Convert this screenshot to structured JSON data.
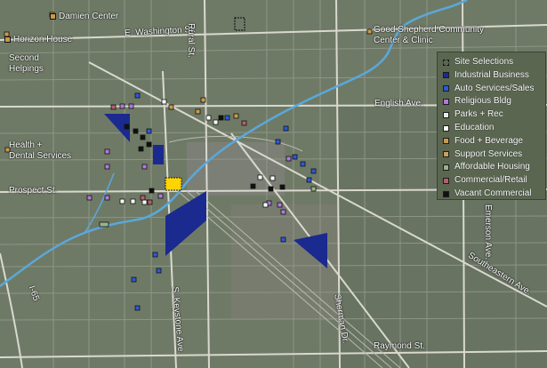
{
  "colors": {
    "industrial": "#1a2a8f",
    "auto": "#2a5ad8",
    "religious": "#b07ad8",
    "parks": "#e8e8f0",
    "education": "#ffffff",
    "food": "#c89a4a",
    "support": "#c8a060",
    "affordable": "#9ab28a",
    "commercial": "#b06070",
    "vacant": "#111111",
    "river": "#5aa8dc",
    "site": "#ffd400",
    "road": "#d8d8d0",
    "terrain": "#6f7a66"
  },
  "legend": {
    "items": [
      {
        "label": "Site Selections",
        "swatch": "site",
        "style": "dashed"
      },
      {
        "label": "Industrial Business",
        "swatch": "industrial"
      },
      {
        "label": "Auto Services/Sales",
        "swatch": "auto"
      },
      {
        "label": "Religious Bldg",
        "swatch": "religious"
      },
      {
        "label": "Parks + Rec",
        "swatch": "parks"
      },
      {
        "label": "Education",
        "swatch": "education"
      },
      {
        "label": "Food + Beverage",
        "swatch": "food"
      },
      {
        "label": "Support Services",
        "swatch": "support"
      },
      {
        "label": "Affordable Housing",
        "swatch": "affordable"
      },
      {
        "label": "Commercial/Retail",
        "swatch": "commercial"
      },
      {
        "label": "Vacant Commercial",
        "swatch": "vacant"
      }
    ]
  },
  "places": {
    "damien_center": "Damien Center",
    "horizon_house": "Horizon House",
    "second_helpings_1": "Second",
    "second_helpings_2": "Helpings",
    "health_dental_1": "Health +",
    "health_dental_2": "Dental Services",
    "good_shepherd_1": "Good Shepherd Community",
    "good_shepherd_2": "Center & Clinic"
  },
  "streets": {
    "washington": "E. Washington St.",
    "rural": "Rural St.",
    "english": "English Ave.",
    "prospect": "Prospect St.",
    "keystone": "S. Keystone Ave.",
    "sherman": "Sherman Dr.",
    "emerson": "Emerson Ave.",
    "southeastern": "Southeastern Ave.",
    "raymond": "Raymond St.",
    "i65": "I-65"
  }
}
